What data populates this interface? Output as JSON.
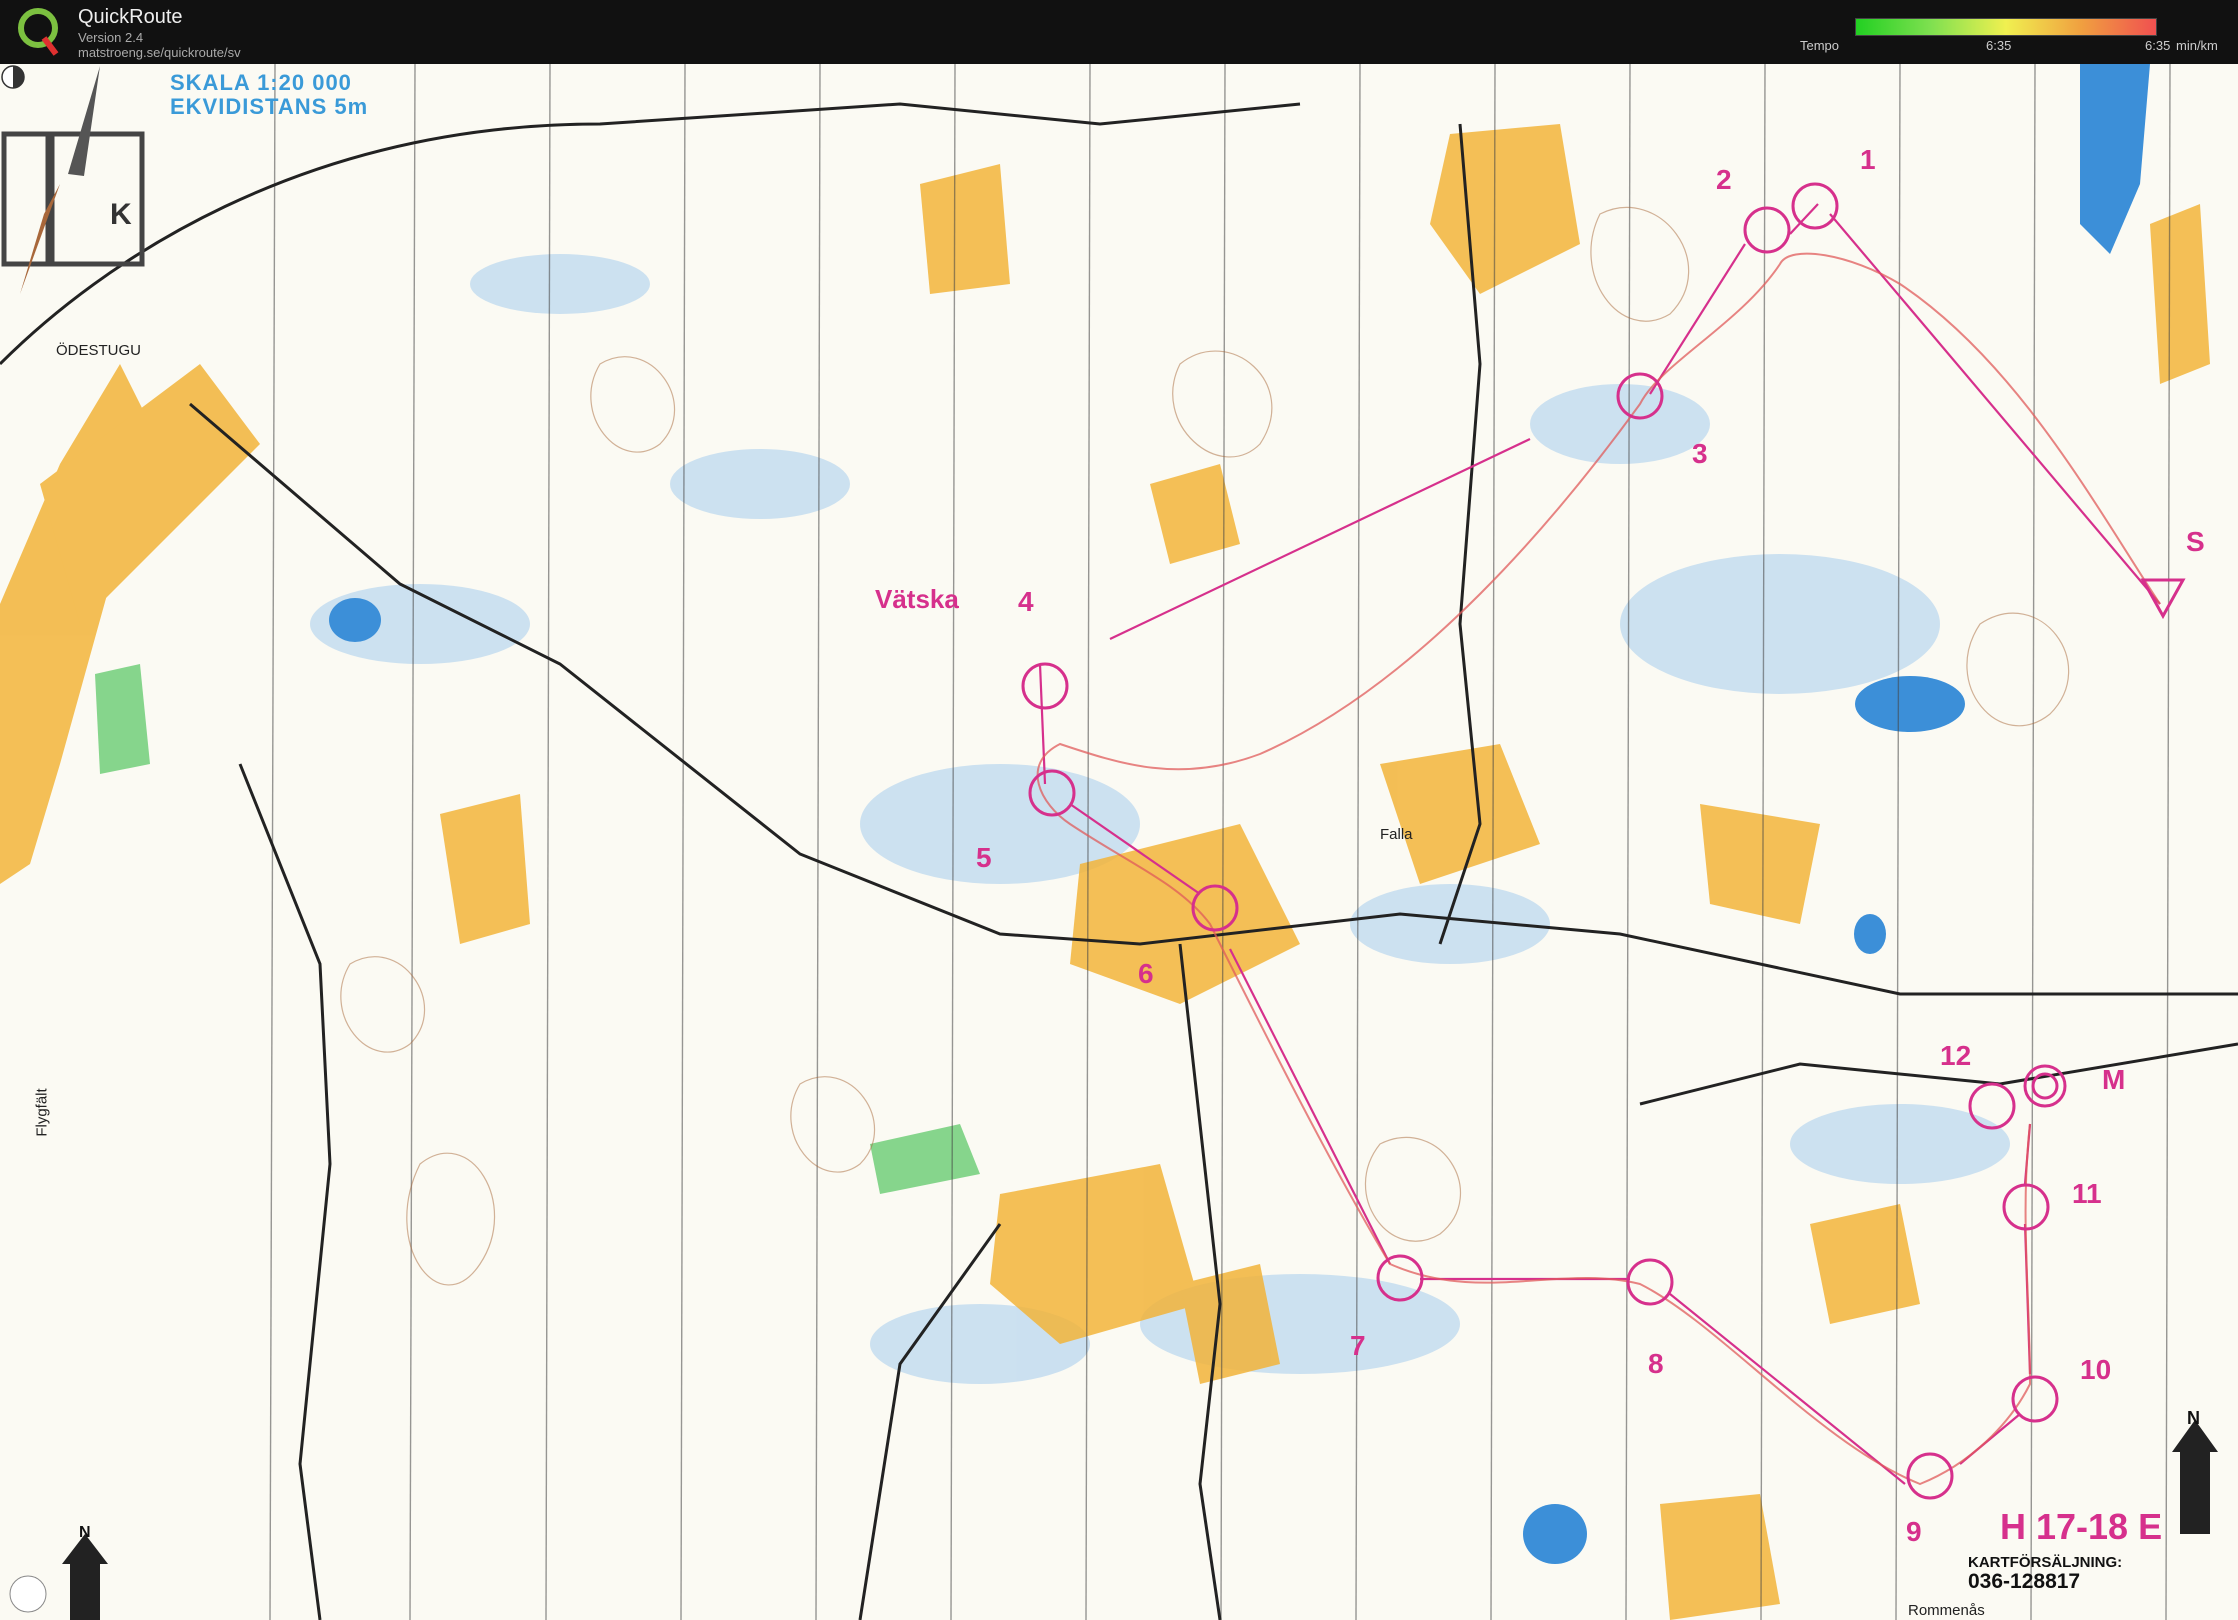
{
  "app": {
    "title": "QuickRoute",
    "version": "Version 2.4",
    "url": "matstroeng.se/quickroute/sv"
  },
  "tempo": {
    "label": "Tempo",
    "mid": "6:35",
    "max": "6:35",
    "unit": "min/km"
  },
  "map": {
    "scale": "SKALA  1:20 000",
    "contour": "EKVIDISTANS  5m",
    "logo_letter": "K",
    "places": {
      "odestugu": "ÖDESTUGU",
      "falla": "Falla",
      "flygfalt": "Flygfält",
      "rommenas": "Rommenås"
    },
    "refreshment": "Vätska",
    "class": "H 17-18 E",
    "sales_label": "KARTFÖRSÄLJNING:",
    "sales_phone": "036-128817",
    "north": "N",
    "start": "S",
    "finish": "M",
    "controls": [
      "1",
      "2",
      "3",
      "4",
      "5",
      "6",
      "7",
      "8",
      "9",
      "10",
      "11",
      "12"
    ]
  },
  "colors": {
    "course": "#d6308c",
    "field": "#f2b43a",
    "water": "#3c8fd8",
    "marsh": "#bcd8ef",
    "green": "#5fc86a",
    "contour": "#a8673a",
    "road": "#222222"
  }
}
